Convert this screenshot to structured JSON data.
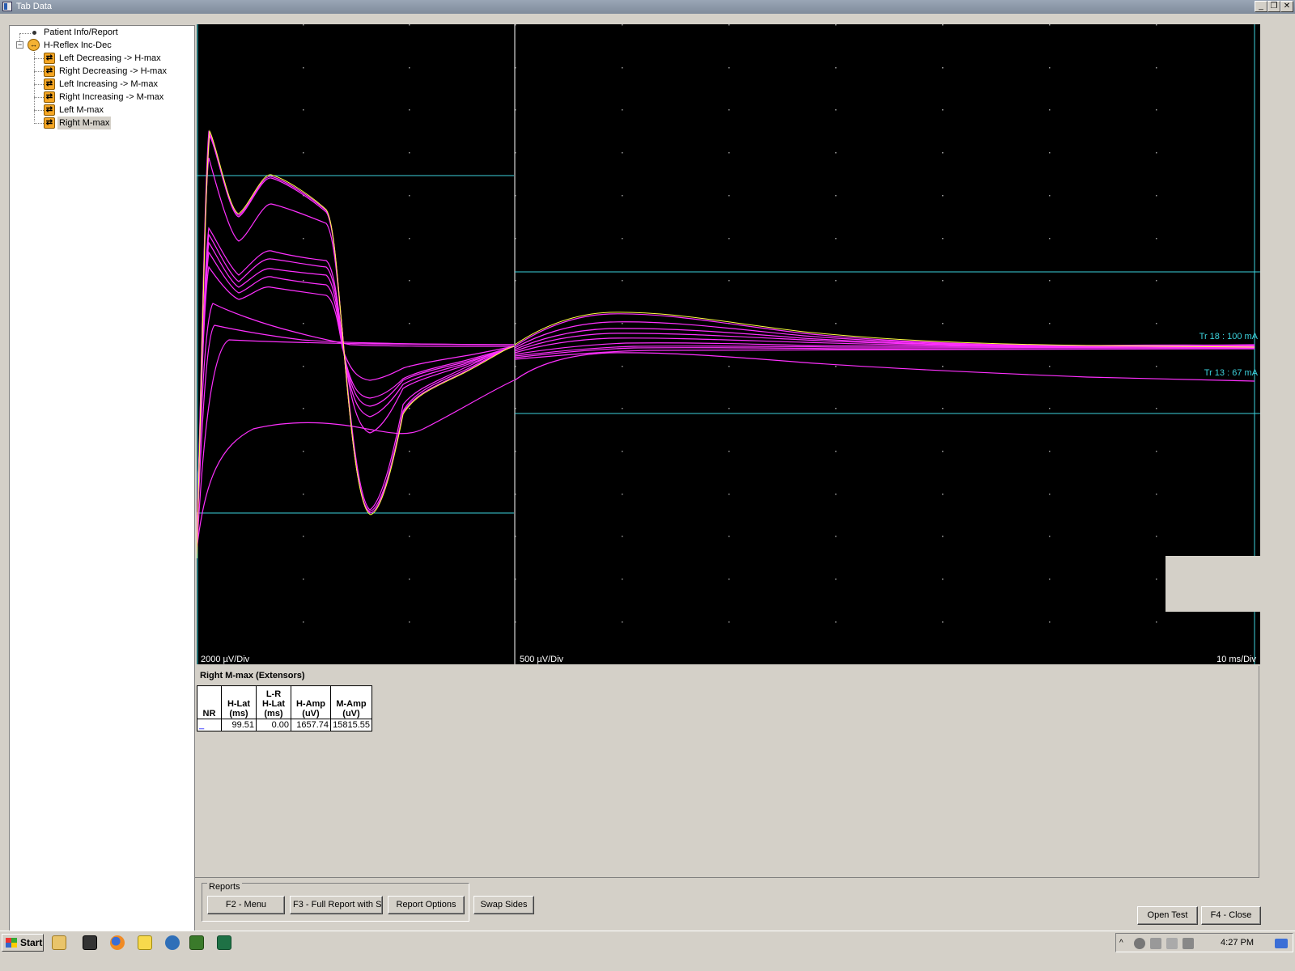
{
  "window": {
    "title": "Tab Data",
    "minimize_label": "_",
    "restore_label": "❐",
    "close_label": "✕"
  },
  "tree": {
    "patient_info": "Patient Info/Report",
    "root": "H-Reflex Inc-Dec",
    "expander_symbol": "−",
    "items": [
      {
        "label": "Left Decreasing -> H-max"
      },
      {
        "label": "Right Decreasing -> H-max"
      },
      {
        "label": "Left Increasing -> M-max"
      },
      {
        "label": "Right Increasing -> M-max"
      },
      {
        "label": "Left M-max"
      },
      {
        "label": "Right M-max",
        "selected": true
      }
    ]
  },
  "waveform": {
    "left_scale": "2000 µV/Div",
    "right_scale": "500 µV/Div",
    "time_scale": "10 ms/Div",
    "trace_labels": [
      "Tr 18 : 100 mA",
      "Tr 13 : 67 mA"
    ],
    "colors": {
      "background": "#000000",
      "trace": "#ff30ff",
      "selected_trace": "#ffff40",
      "cursor": "#3cd2dc"
    }
  },
  "report": {
    "heading": "Right M-max (Extensors)",
    "columns": [
      [
        "NR"
      ],
      [
        "H-Lat",
        "(ms)"
      ],
      [
        "L-R",
        "H-Lat",
        "(ms)"
      ],
      [
        "H-Amp",
        "(uV)"
      ],
      [
        "M-Amp",
        "(uV)"
      ]
    ],
    "rows": [
      {
        "nr": "_",
        "h_lat": "99.51",
        "lr_h_lat": "0.00",
        "h_amp": "1657.74",
        "m_amp": "15815.55"
      }
    ]
  },
  "reports_group": {
    "legend": "Reports",
    "menu_button": "F2 - Menu",
    "full_report_button": "F3 - Full Report with S...",
    "options_button": "Report Options"
  },
  "swap_sides_button": "Swap Sides",
  "open_test_button": "Open Test",
  "close_button": "F4 - Close",
  "taskbar": {
    "start_label": "Start",
    "clock": "4:27 PM"
  }
}
